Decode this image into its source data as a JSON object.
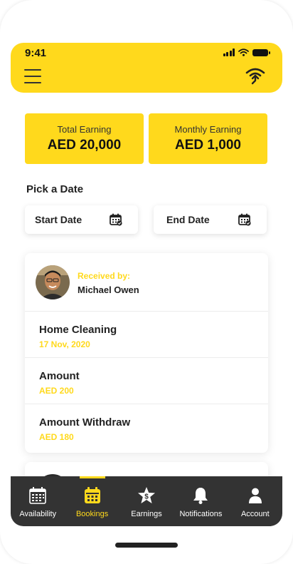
{
  "status_bar": {
    "time": "9:41"
  },
  "colors": {
    "accent": "#FFD91C",
    "dark": "#333333",
    "text": "#222222"
  },
  "header": {
    "menu_icon": "hamburger-menu-icon",
    "action_icon": "route-signal-icon"
  },
  "earnings": {
    "total": {
      "label": "Total Earning",
      "value": "AED 20,000"
    },
    "monthly": {
      "label": "Monthly Earning",
      "value": "AED 1,000"
    }
  },
  "date_picker": {
    "title": "Pick a Date",
    "start": {
      "label": "Start Date",
      "icon": "calendar-icon"
    },
    "end": {
      "label": "End Date",
      "icon": "calendar-icon"
    }
  },
  "booking": {
    "received_label": "Received by:",
    "received_name": "Michael Owen",
    "service": {
      "title": "Home Cleaning",
      "date": "17 Nov, 2020"
    },
    "amount": {
      "title": "Amount",
      "value": "AED 200"
    },
    "withdraw": {
      "title": "Amount Withdraw",
      "value": "AED 180"
    }
  },
  "tabs": [
    {
      "label": "Availability",
      "icon": "calendar-grid-icon",
      "active": false
    },
    {
      "label": "Bookings",
      "icon": "calendar-icon",
      "active": true
    },
    {
      "label": "Earnings",
      "icon": "dollar-star-icon",
      "active": false
    },
    {
      "label": "Notifications",
      "icon": "bell-icon",
      "active": false
    },
    {
      "label": "Account",
      "icon": "user-icon",
      "active": false
    }
  ]
}
